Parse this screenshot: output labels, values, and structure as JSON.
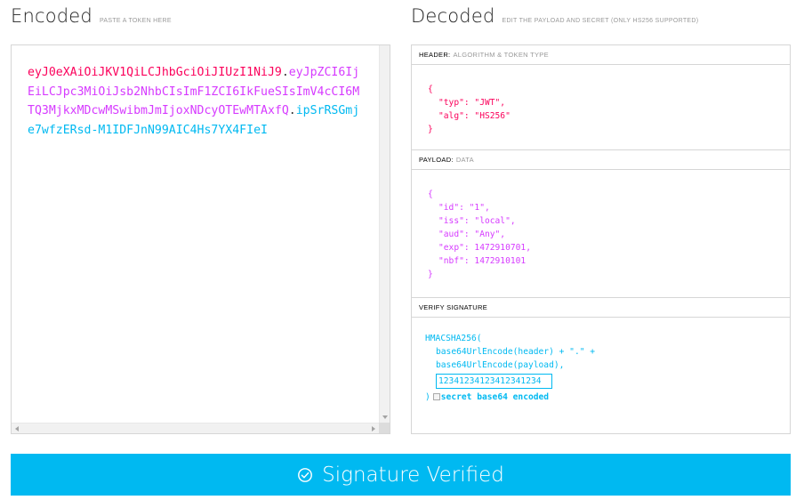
{
  "encoded": {
    "title": "Encoded",
    "subtitle": "PASTE A TOKEN HERE",
    "token_header": "eyJ0eXAiOiJKV1QiLCJhbGciOiJIUzI1NiJ9",
    "token_payload": "eyJpZCI6IjEiLCJpc3MiOiJsb2NhbCIsImF1ZCI6IkFueSIsImV4cCI6MTQ3MjkxMDcwMSwibmJmIjoxNDcyOTEwMTAxfQ",
    "token_signature": "ipSrRSGmje7wfzERsd-M1IDFJnN99AIC4Hs7YX4FIeI",
    "dot": "."
  },
  "decoded": {
    "title": "Decoded",
    "subtitle": "EDIT THE PAYLOAD AND SECRET (ONLY HS256 SUPPORTED)",
    "header": {
      "label": "HEADER:",
      "sublabel": "ALGORITHM & TOKEN TYPE",
      "lines": [
        "{",
        "\"typ\": \"JWT\",",
        "\"alg\": \"HS256\"",
        "}"
      ]
    },
    "payload": {
      "label": "PAYLOAD:",
      "sublabel": "DATA",
      "lines": [
        "{",
        "\"id\": \"1\",",
        "\"iss\": \"local\",",
        "\"aud\": \"Any\",",
        "\"exp\": 1472910701,",
        "\"nbf\": 1472910101",
        "}"
      ]
    },
    "signature": {
      "label": "VERIFY SIGNATURE",
      "line1": "HMACSHA256(",
      "line2": "base64UrlEncode(header) + \".\" +",
      "line3": "base64UrlEncode(payload),",
      "secret_value": "12341234123412341234",
      "close": ")",
      "checkbox_label": "secret base64 encoded"
    }
  },
  "status": {
    "label": "Signature Verified",
    "color": "#00b9f1"
  },
  "colors": {
    "header": "#fb015b",
    "payload": "#d63aff",
    "signature": "#00b9f1"
  }
}
